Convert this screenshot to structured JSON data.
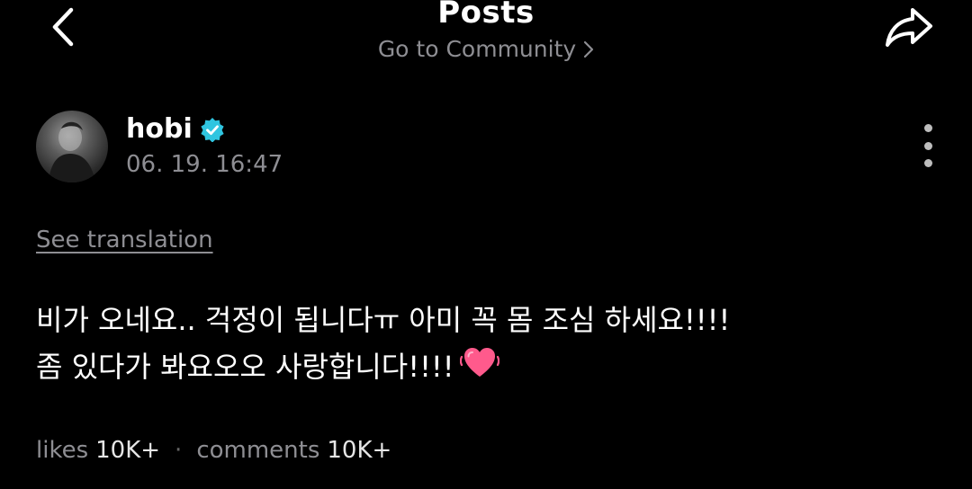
{
  "header": {
    "title": "Posts",
    "community_link": "Go to Community",
    "back_icon": "chevron-left-icon",
    "share_icon": "share-arrow-icon"
  },
  "post": {
    "author": {
      "name": "hobi",
      "verified": true,
      "verified_color": "#2fc5e0"
    },
    "timestamp": "06. 19. 16:47",
    "see_translation": "See translation",
    "body_lines": [
      "비가 오네요.. 걱정이 됩니다ㅠ 아미 꼭 몸 조심 하세요!!!!",
      "좀 있다가 봐요오오 사랑합니다!!!!"
    ],
    "emoji_icon": "pink-heart-icon",
    "stats": {
      "likes_label": "likes",
      "likes_value": "10K+",
      "separator": "·",
      "comments_label": "comments",
      "comments_value": "10K+"
    }
  },
  "colors": {
    "background": "#000000",
    "muted_text": "#8e8e93",
    "heart": "#ff5a8c"
  }
}
